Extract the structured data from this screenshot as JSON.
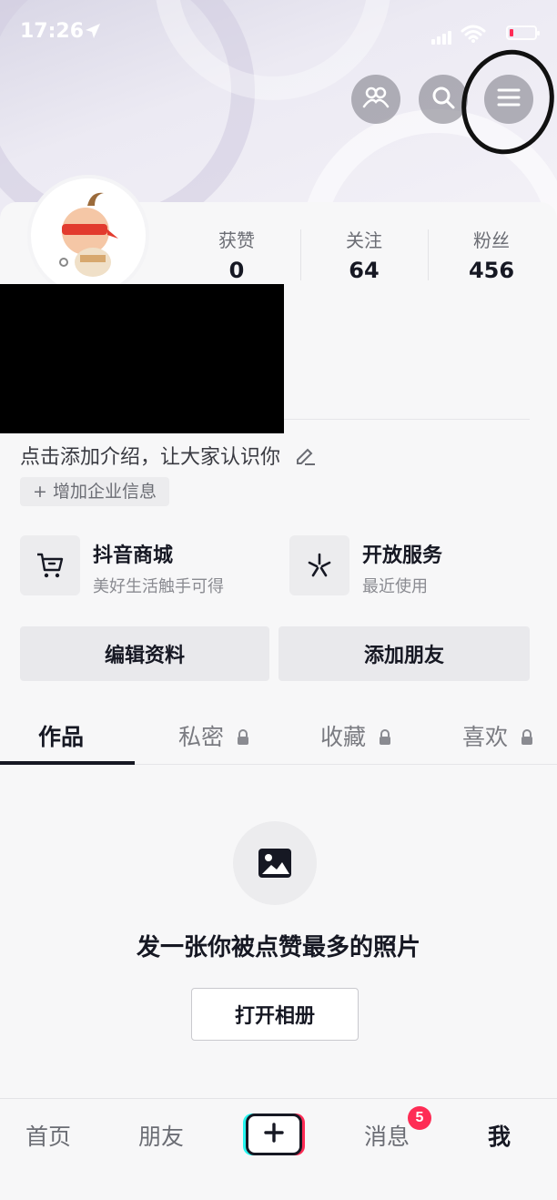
{
  "status_bar": {
    "time": "17:26"
  },
  "header": {
    "buttons": [
      {
        "icon": "friends-icon"
      },
      {
        "icon": "search-icon"
      },
      {
        "icon": "menu-icon"
      }
    ]
  },
  "profile": {
    "stats": [
      {
        "label": "获赞",
        "value": "0"
      },
      {
        "label": "关注",
        "value": "64"
      },
      {
        "label": "粉丝",
        "value": "456"
      }
    ],
    "bio": "点击添加介绍，让大家认识你",
    "enterprise_label": "+ 增加企业信息"
  },
  "services": [
    {
      "icon": "cart-icon",
      "title": "抖音商城",
      "subtitle": "美好生活触手可得"
    },
    {
      "icon": "asterisk-icon",
      "title": "开放服务",
      "subtitle": "最近使用"
    }
  ],
  "actions": {
    "edit_profile": "编辑资料",
    "add_friends": "添加朋友"
  },
  "content_tabs": [
    {
      "label": "作品",
      "active": true,
      "locked": false
    },
    {
      "label": "私密",
      "active": false,
      "locked": true
    },
    {
      "label": "收藏",
      "active": false,
      "locked": true
    },
    {
      "label": "喜欢",
      "active": false,
      "locked": true
    }
  ],
  "empty_state": {
    "icon": "image-icon",
    "title": "发一张你被点赞最多的照片",
    "button": "打开相册"
  },
  "bottom_nav": {
    "home": "首页",
    "friends": "朋友",
    "create_icon": "plus-icon",
    "messages": "消息",
    "messages_badge": "5",
    "me": "我"
  },
  "colors": {
    "accent_red": "#fe2c55",
    "accent_cyan": "#25f4ee",
    "text_primary": "#161823"
  }
}
